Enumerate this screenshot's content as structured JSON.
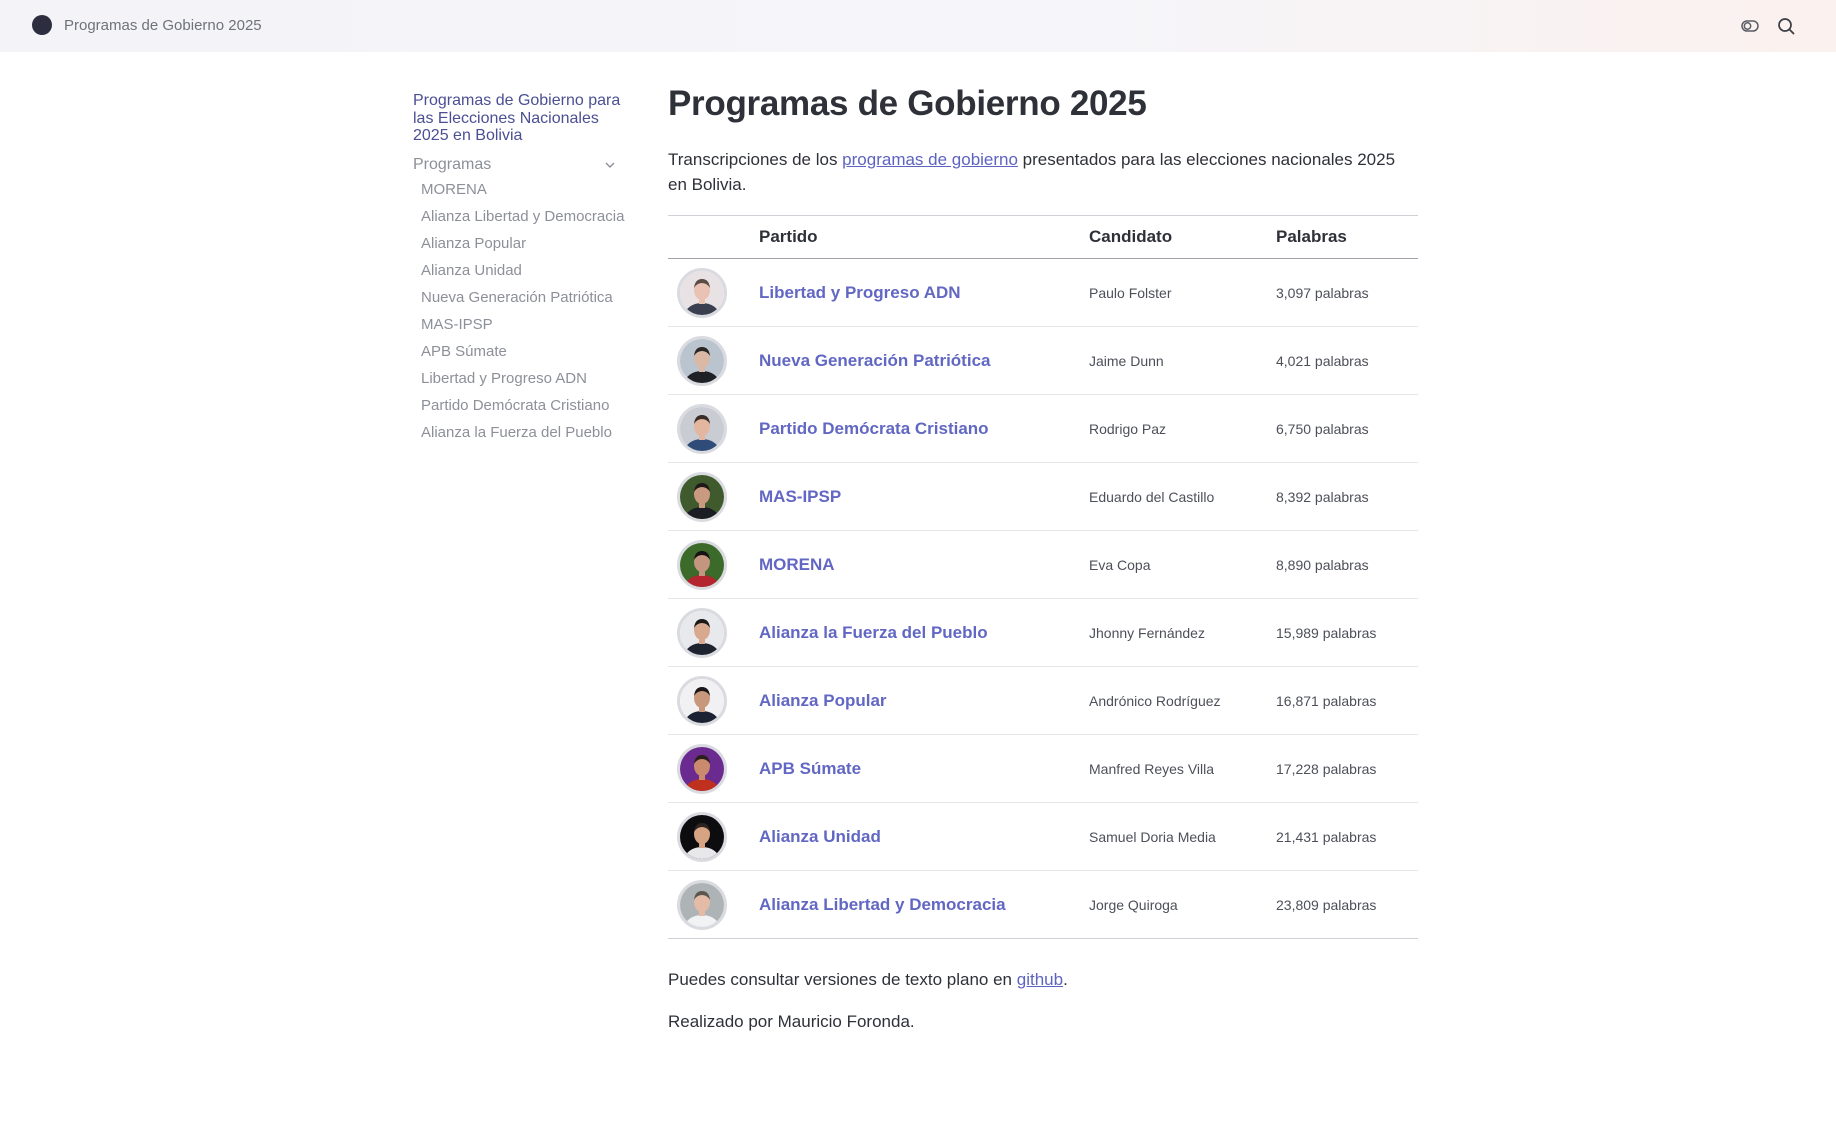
{
  "header": {
    "site_title": "Programas de Gobierno 2025",
    "icons": [
      "theme-toggle-icon",
      "search-icon"
    ]
  },
  "sidebar": {
    "title": "Programas de Gobierno para las Elecciones Nacionales 2025 en Bolivia",
    "section_label": "Programas",
    "items": [
      "MORENA",
      "Alianza Libertad y Democracia",
      "Alianza Popular",
      "Alianza Unidad",
      "Nueva Generación Patriótica",
      "MAS-IPSP",
      "APB Súmate",
      "Libertad y Progreso ADN",
      "Partido Demócrata Cristiano",
      "Alianza la Fuerza del Pueblo"
    ]
  },
  "main": {
    "title": "Programas de Gobierno 2025",
    "intro_before": "Transcripciones de los ",
    "intro_link": "programas de gobierno",
    "intro_after": " presentados para las elecciones nacionales 2025 en Bolivia.",
    "table": {
      "headers": [
        "",
        "Partido",
        "Candidato",
        "Palabras"
      ],
      "rows": [
        {
          "party": "Libertad y Progreso ADN",
          "candidate": "Paulo Folster",
          "words": "3,097 palabras"
        },
        {
          "party": "Nueva Generación Patriótica",
          "candidate": "Jaime Dunn",
          "words": "4,021 palabras"
        },
        {
          "party": "Partido Demócrata Cristiano",
          "candidate": "Rodrigo Paz",
          "words": "6,750 palabras"
        },
        {
          "party": "MAS-IPSP",
          "candidate": "Eduardo del Castillo",
          "words": "8,392 palabras"
        },
        {
          "party": "MORENA",
          "candidate": "Eva Copa",
          "words": "8,890 palabras"
        },
        {
          "party": "Alianza la Fuerza del Pueblo",
          "candidate": "Jhonny Fernández",
          "words": "15,989 palabras"
        },
        {
          "party": "Alianza Popular",
          "candidate": "Andrónico Rodríguez",
          "words": "16,871 palabras"
        },
        {
          "party": "APB Súmate",
          "candidate": "Manfred Reyes Villa",
          "words": "17,228 palabras"
        },
        {
          "party": "Alianza Unidad",
          "candidate": "Samuel Doria Media",
          "words": "21,431 palabras"
        },
        {
          "party": "Alianza Libertad y Democracia",
          "candidate": "Jorge Quiroga",
          "words": "23,809 palabras"
        }
      ]
    },
    "footer_before": "Puedes consultar versiones de texto plano en ",
    "footer_link": "github",
    "footer_after": ".",
    "credit": "Realizado por Mauricio Foronda."
  },
  "colors": {
    "link": "#6167c3",
    "sidebar_title": "#4b4f93",
    "text": "#2f3139",
    "muted": "#8d9098"
  }
}
